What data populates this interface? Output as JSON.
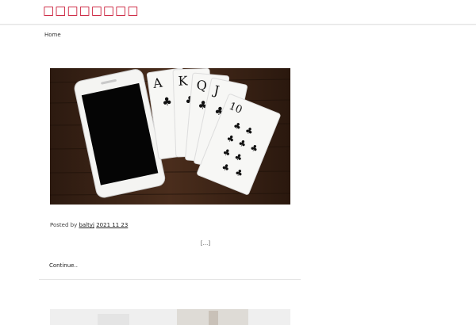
{
  "header": {
    "site_title": "□□□□□□□□"
  },
  "breadcrumb": {
    "home_label": "Home"
  },
  "post": {
    "meta_prefix": "Posted by",
    "author": "baltyj",
    "date": "2021 11 23",
    "excerpt": "[...]",
    "continue_label": "Continue.."
  },
  "colors": {
    "accent": "#c8102e"
  }
}
